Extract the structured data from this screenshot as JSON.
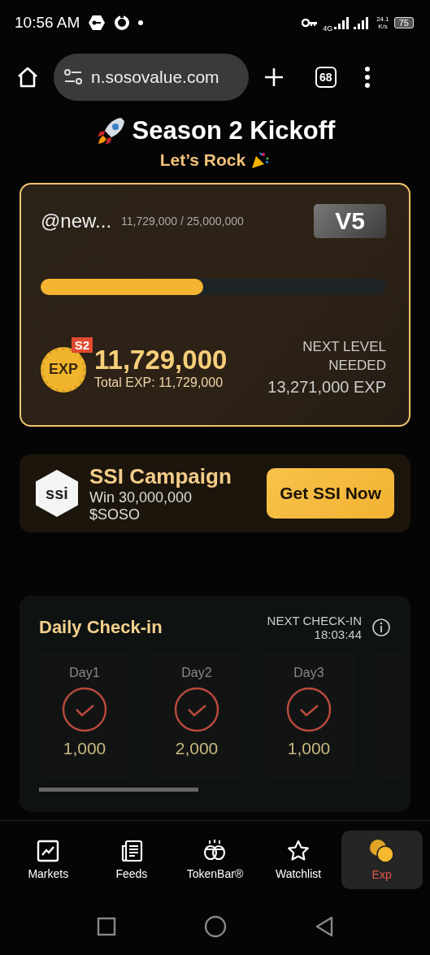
{
  "status_bar": {
    "time": "10:56 AM",
    "network": "4G",
    "speed_value": "24.1",
    "speed_unit": "K/s",
    "battery": "75"
  },
  "browser": {
    "url": "n.sosovalue.com",
    "tab_count": "68"
  },
  "header": {
    "title": "Season 2 Kickoff",
    "subtitle": "Let’s Rock"
  },
  "level_card": {
    "username": "@new...",
    "progress_text": "11,729,000 / 25,000,000",
    "level": 0.47,
    "vip_level": "V5",
    "season_badge": "S2",
    "medal_label": "EXP",
    "exp_value": "11,729,000",
    "total_exp": "Total EXP: 11,729,000",
    "next_level_label": "NEXT LEVEL NEEDED",
    "next_level_value": "13,271,000 EXP"
  },
  "campaign": {
    "logo_text": "ssi",
    "title": "SSI Campaign",
    "description": "Win 30,000,000 $SOSO",
    "button": "Get SSI Now"
  },
  "daily_checkin": {
    "title": "Daily Check-in",
    "next_label": "NEXT CHECK-IN",
    "countdown": "18:03:44",
    "days": [
      {
        "label": "Day1",
        "reward": "1,000",
        "checked": true
      },
      {
        "label": "Day2",
        "reward": "2,000",
        "checked": true
      },
      {
        "label": "Day3",
        "reward": "1,000",
        "checked": true
      }
    ]
  },
  "bottom_nav": [
    {
      "kind": "markets",
      "label": "Markets",
      "selected": false
    },
    {
      "kind": "feeds",
      "label": "Feeds",
      "selected": false
    },
    {
      "kind": "tokenbar",
      "label": "TokenBar®",
      "selected": false
    },
    {
      "kind": "watchlist",
      "label": "Watchlist",
      "selected": false
    },
    {
      "kind": "exp",
      "label": "Exp",
      "selected": true
    }
  ]
}
